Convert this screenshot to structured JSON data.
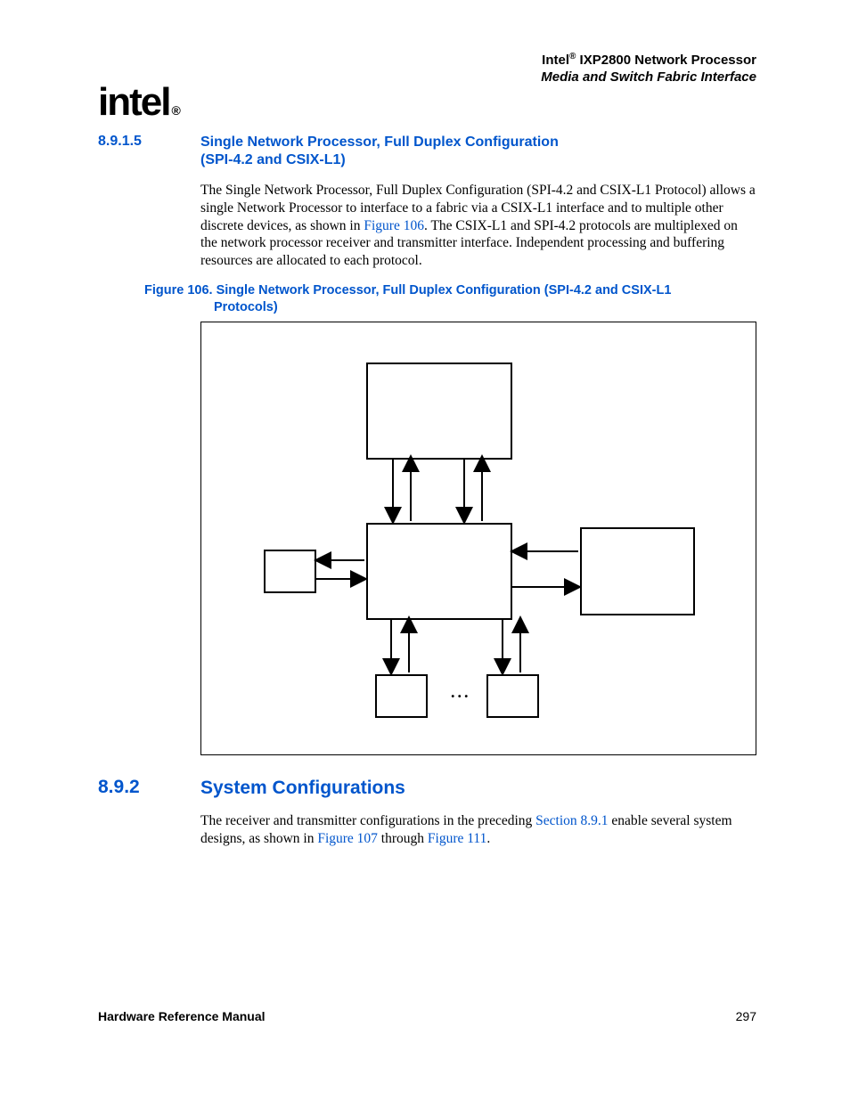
{
  "header": {
    "brand": "Intel",
    "reg": "®",
    "product": " IXP2800 Network Processor",
    "subtitle": "Media and Switch Fabric Interface"
  },
  "logo": {
    "text": "intel",
    "tm": "®"
  },
  "section1": {
    "num": "8.9.1.5",
    "title_l1": "Single Network Processor, Full Duplex Configuration",
    "title_l2": "(SPI-4.2 and CSIX-L1)"
  },
  "para1": {
    "t1": "The Single Network Processor, Full Duplex Configuration (SPI-4.2 and CSIX-L1 Protocol) allows a single Network Processor to interface to a fabric via a CSIX-L1 interface and to multiple other discrete devices, as shown in ",
    "xref": "Figure 106",
    "t2": ". The CSIX-L1 and SPI-4.2 protocols are multiplexed on the network processor receiver and transmitter interface. Independent processing and buffering resources are allocated to each protocol."
  },
  "figcap": {
    "prefix": "Figure 106. ",
    "title_l1": "Single Network Processor, Full Duplex Configuration (SPI-4.2 and CSIX-L1",
    "title_l2": "Protocols)"
  },
  "diagram": {
    "ellipsis": "..."
  },
  "section2": {
    "num": "8.9.2",
    "title": "System Configurations"
  },
  "para2": {
    "t1": "The receiver and transmitter configurations in the preceding ",
    "xref1": "Section 8.9.1",
    "t2": " enable several system designs, as shown in ",
    "xref2": "Figure 107",
    "t3": " through ",
    "xref3": "Figure 111",
    "t4": "."
  },
  "footer": {
    "left": "Hardware Reference Manual",
    "right": "297"
  }
}
